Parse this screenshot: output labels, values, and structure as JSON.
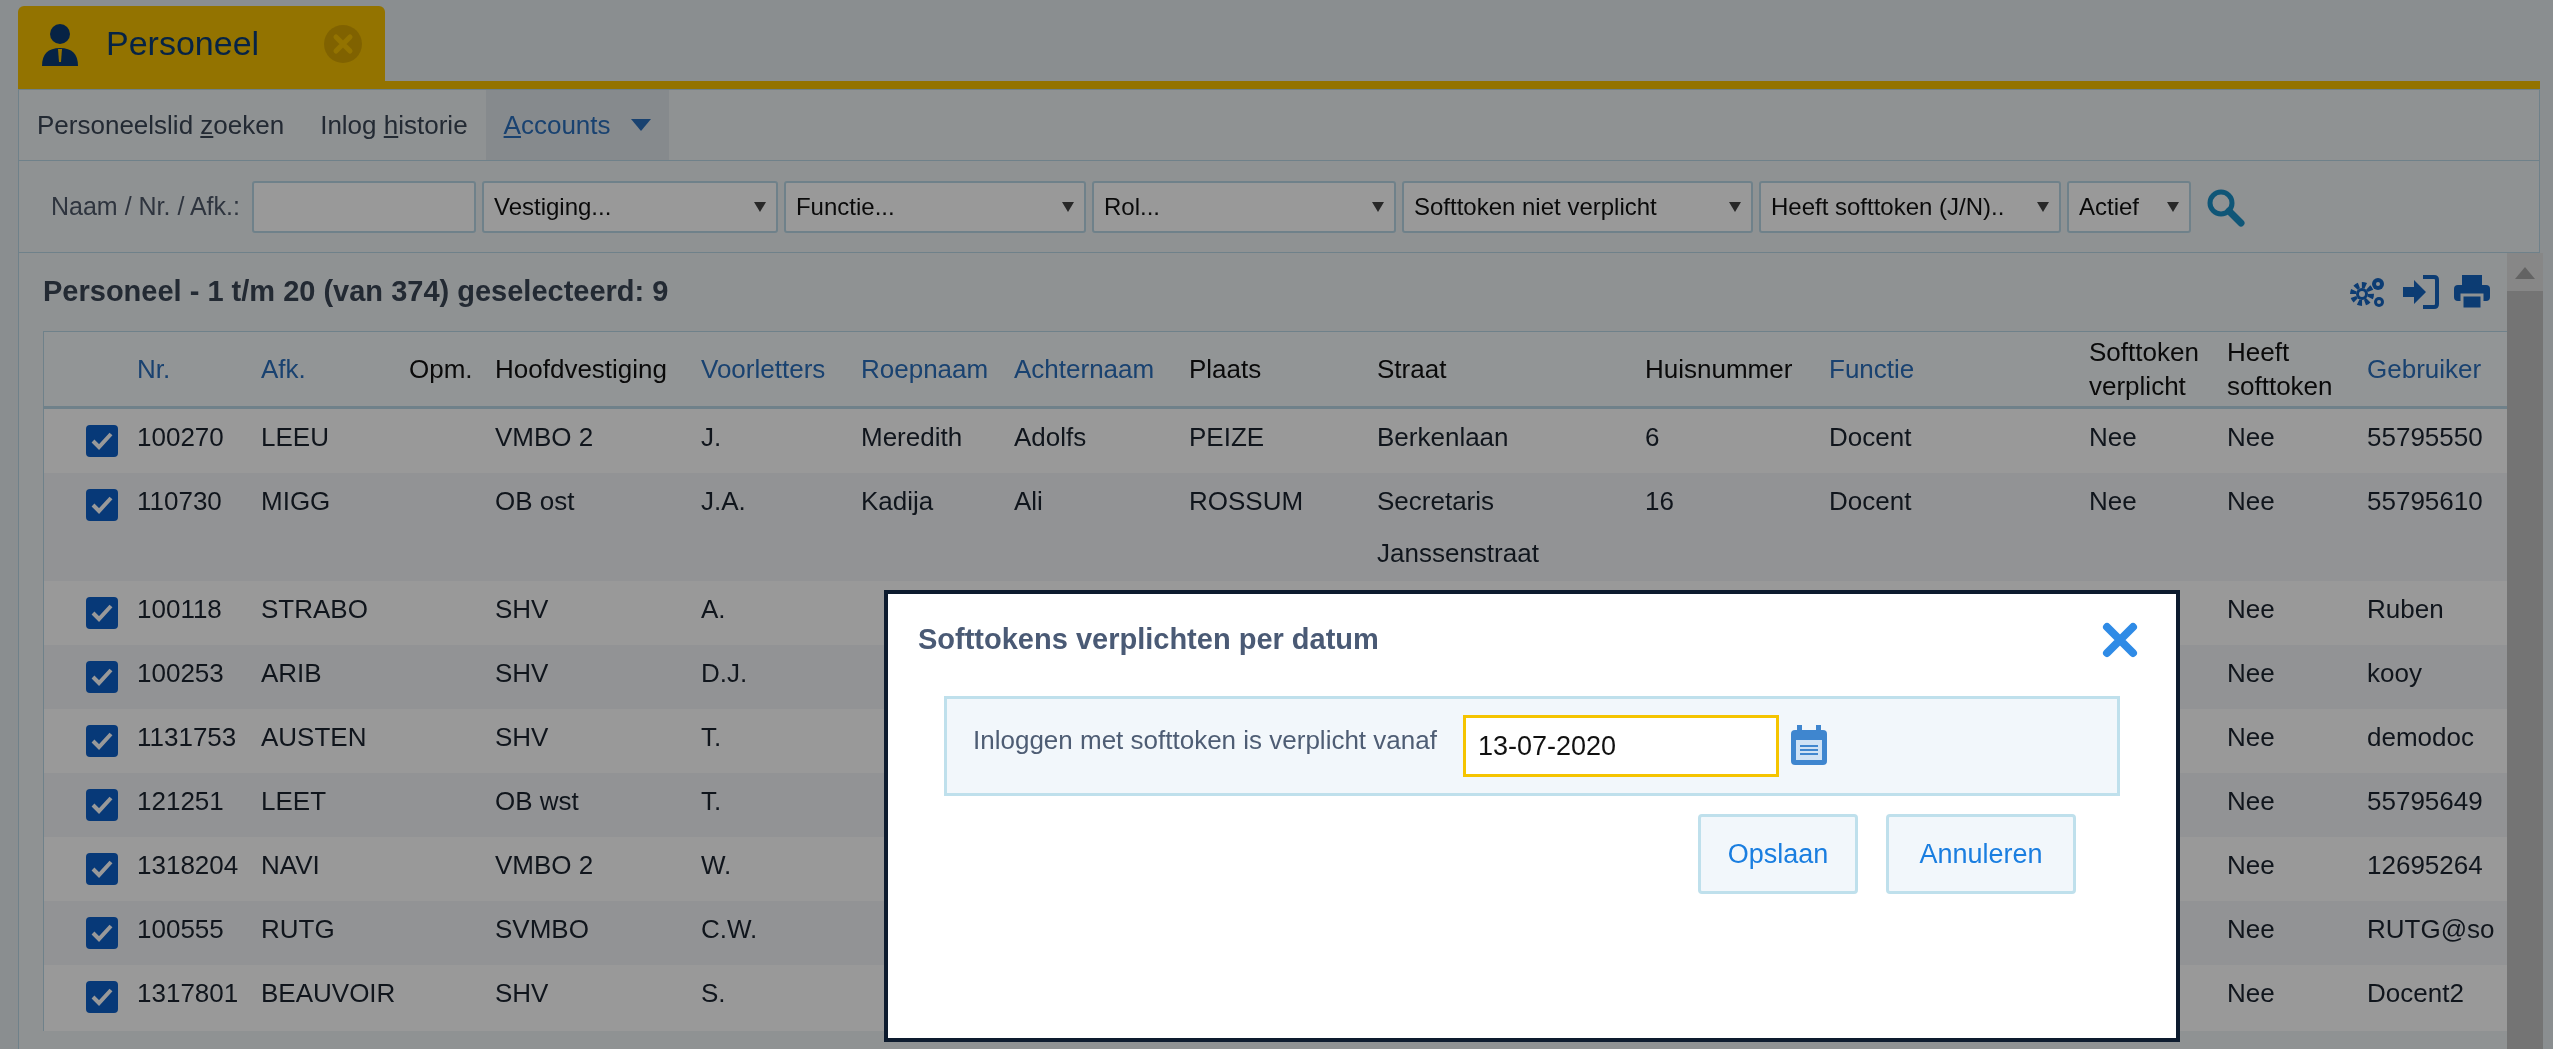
{
  "main_tab": {
    "label": "Personeel",
    "selected": true
  },
  "sub_tabs": [
    {
      "before": "Personeelslid ",
      "key": "z",
      "after": "oeken",
      "selected": false,
      "dropdown": false
    },
    {
      "before": "Inlog ",
      "key": "h",
      "after": "istorie",
      "selected": false,
      "dropdown": false
    },
    {
      "key": "A",
      "after": "ccounts",
      "selected": true,
      "dropdown": true
    }
  ],
  "filters": {
    "label": "Naam / Nr. / Afk.:",
    "selects": [
      {
        "value": "Vestiging..."
      },
      {
        "value": "Functie..."
      },
      {
        "value": "Rol..."
      },
      {
        "value": "Softtoken niet verplicht"
      },
      {
        "value": "Heeft softtoken (J/N).."
      },
      {
        "value": "Actief"
      }
    ]
  },
  "list_heading": "Personeel - 1 t/m 20 (van 374) geselecteerd: 9",
  "table": {
    "columns": [
      {
        "label": "Nr.",
        "sortable": true
      },
      {
        "label": "Afk.",
        "sortable": true
      },
      {
        "label": "Opm.",
        "sortable": false
      },
      {
        "label": "Hoofdvestiging",
        "sortable": false
      },
      {
        "label": "Voorletters",
        "sortable": true
      },
      {
        "label": "Roepnaam",
        "sortable": true
      },
      {
        "label": "Achternaam",
        "sortable": true
      },
      {
        "label": "Plaats",
        "sortable": false
      },
      {
        "label": "Straat",
        "sortable": false
      },
      {
        "label": "Huisnummer",
        "sortable": false
      },
      {
        "label": "Functie",
        "sortable": true
      },
      {
        "label": "Softtoken verplicht",
        "sortable": false
      },
      {
        "label": "Heeft softtoken",
        "sortable": false
      },
      {
        "label": "Gebruiker",
        "sortable": true
      }
    ],
    "rows": [
      {
        "checked": true,
        "cells": [
          "100270",
          "LEEU",
          null,
          "VMBO 2",
          "J.",
          "Meredith",
          "Adolfs",
          "PEIZE",
          "Berkenlaan",
          "6",
          "Docent",
          "Nee",
          "Nee",
          "55795550"
        ]
      },
      {
        "checked": true,
        "cells": [
          "110730",
          "MIGG",
          null,
          "OB ost",
          "J.A.",
          "Kadija",
          "Ali",
          "ROSSUM",
          "Secretaris Janssenstraat",
          "16",
          "Docent",
          "Nee",
          "Nee",
          "55795610"
        ]
      },
      {
        "checked": true,
        "cells": [
          "100118",
          "STRABO",
          null,
          "SHV",
          "A.",
          null,
          null,
          null,
          null,
          null,
          null,
          null,
          "Nee",
          "Ruben"
        ]
      },
      {
        "checked": true,
        "cells": [
          "100253",
          "ARIB",
          null,
          "SHV",
          "D.J.",
          null,
          null,
          null,
          null,
          null,
          null,
          null,
          "Nee",
          "kooy"
        ]
      },
      {
        "checked": true,
        "cells": [
          "1131753",
          "AUSTEN",
          null,
          "SHV",
          "T.",
          null,
          null,
          null,
          null,
          null,
          null,
          null,
          "Nee",
          "demodoc"
        ]
      },
      {
        "checked": true,
        "cells": [
          "121251",
          "LEET",
          null,
          "OB wst",
          "T.",
          null,
          null,
          null,
          null,
          null,
          null,
          null,
          "Nee",
          "55795649"
        ]
      },
      {
        "checked": true,
        "cells": [
          "1318204",
          "NAVI",
          null,
          "VMBO 2",
          "W.",
          null,
          null,
          null,
          null,
          null,
          null,
          null,
          "Nee",
          "12695264"
        ]
      },
      {
        "checked": true,
        "cells": [
          "100555",
          "RUTG",
          null,
          "SVMBO",
          "C.W.",
          null,
          null,
          null,
          null,
          null,
          null,
          null,
          "Nee",
          "RUTG@so"
        ]
      },
      {
        "checked": true,
        "cells": [
          "1317801",
          "BEAUVOIR",
          null,
          "SHV",
          "S.",
          null,
          null,
          null,
          null,
          null,
          null,
          null,
          "Nee",
          "Docent2"
        ]
      }
    ]
  },
  "dialog": {
    "title": "Softtokens verplichten per datum",
    "field_label": "Inloggen met softtoken is verplicht vanaf",
    "date_field": {
      "value": "13-07-2020"
    },
    "buttons": [
      "Opslaan",
      "Annuleren"
    ]
  }
}
